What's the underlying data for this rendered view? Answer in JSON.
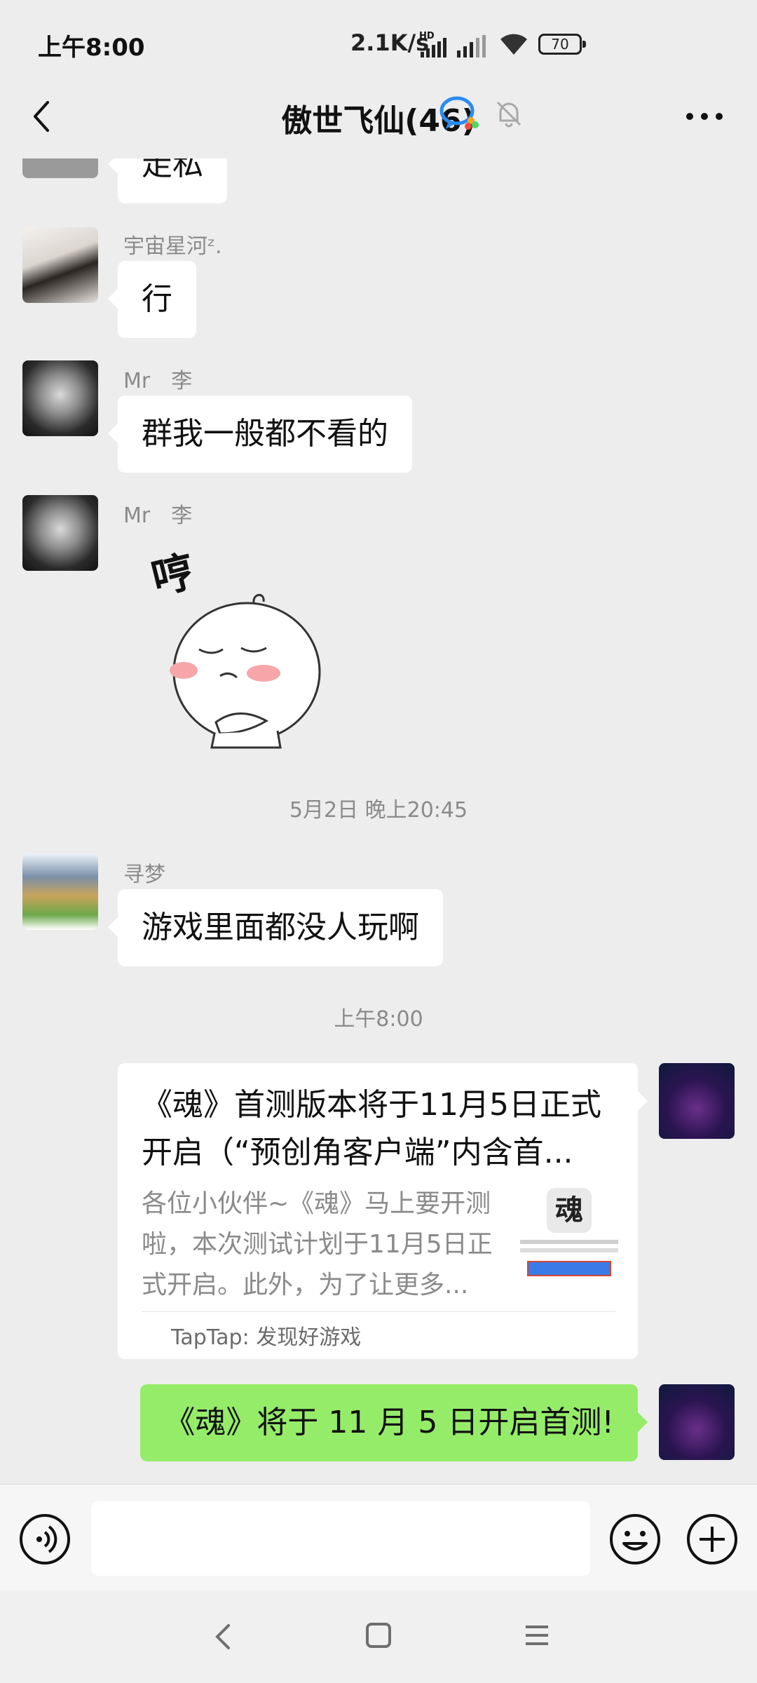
{
  "status_bar": {
    "time": "上午8:00",
    "net_speed": "2.1K/s",
    "hd_label": "HD",
    "battery": "70"
  },
  "header": {
    "title": "傲世飞仙(46)"
  },
  "messages": {
    "top_partial_text": "走私",
    "m1": {
      "sender": "宇宙星河ᶻ.",
      "text": "行"
    },
    "m2": {
      "sender": "Mr　李",
      "text": "群我一般都不看的"
    },
    "m3": {
      "sender": "Mr　李",
      "sticker": "哼"
    },
    "ts1": "5月2日 晚上20:45",
    "m4": {
      "sender": "寻梦",
      "text": "游戏里面都没人玩啊"
    },
    "ts2": "上午8:00",
    "card": {
      "title": "《魂》首测版本将于11月5日正式开启（“预创角客户端”内含首...",
      "description": "各位小伙伴~《魂》马上要开测啦，本次测试计划于11月5日正式开启。此外，为了让更多...",
      "source": "TapTap: 发现好游戏",
      "thumb_char": "魂"
    },
    "m5": {
      "text": "《魂》将于 11 月 5 日开启首测!"
    }
  },
  "input": {
    "value": "",
    "placeholder": ""
  },
  "colors": {
    "background": "#ededed",
    "bubble_self": "#95ec69",
    "bubble_other": "#ffffff",
    "meta_text": "#8a8a8a"
  }
}
